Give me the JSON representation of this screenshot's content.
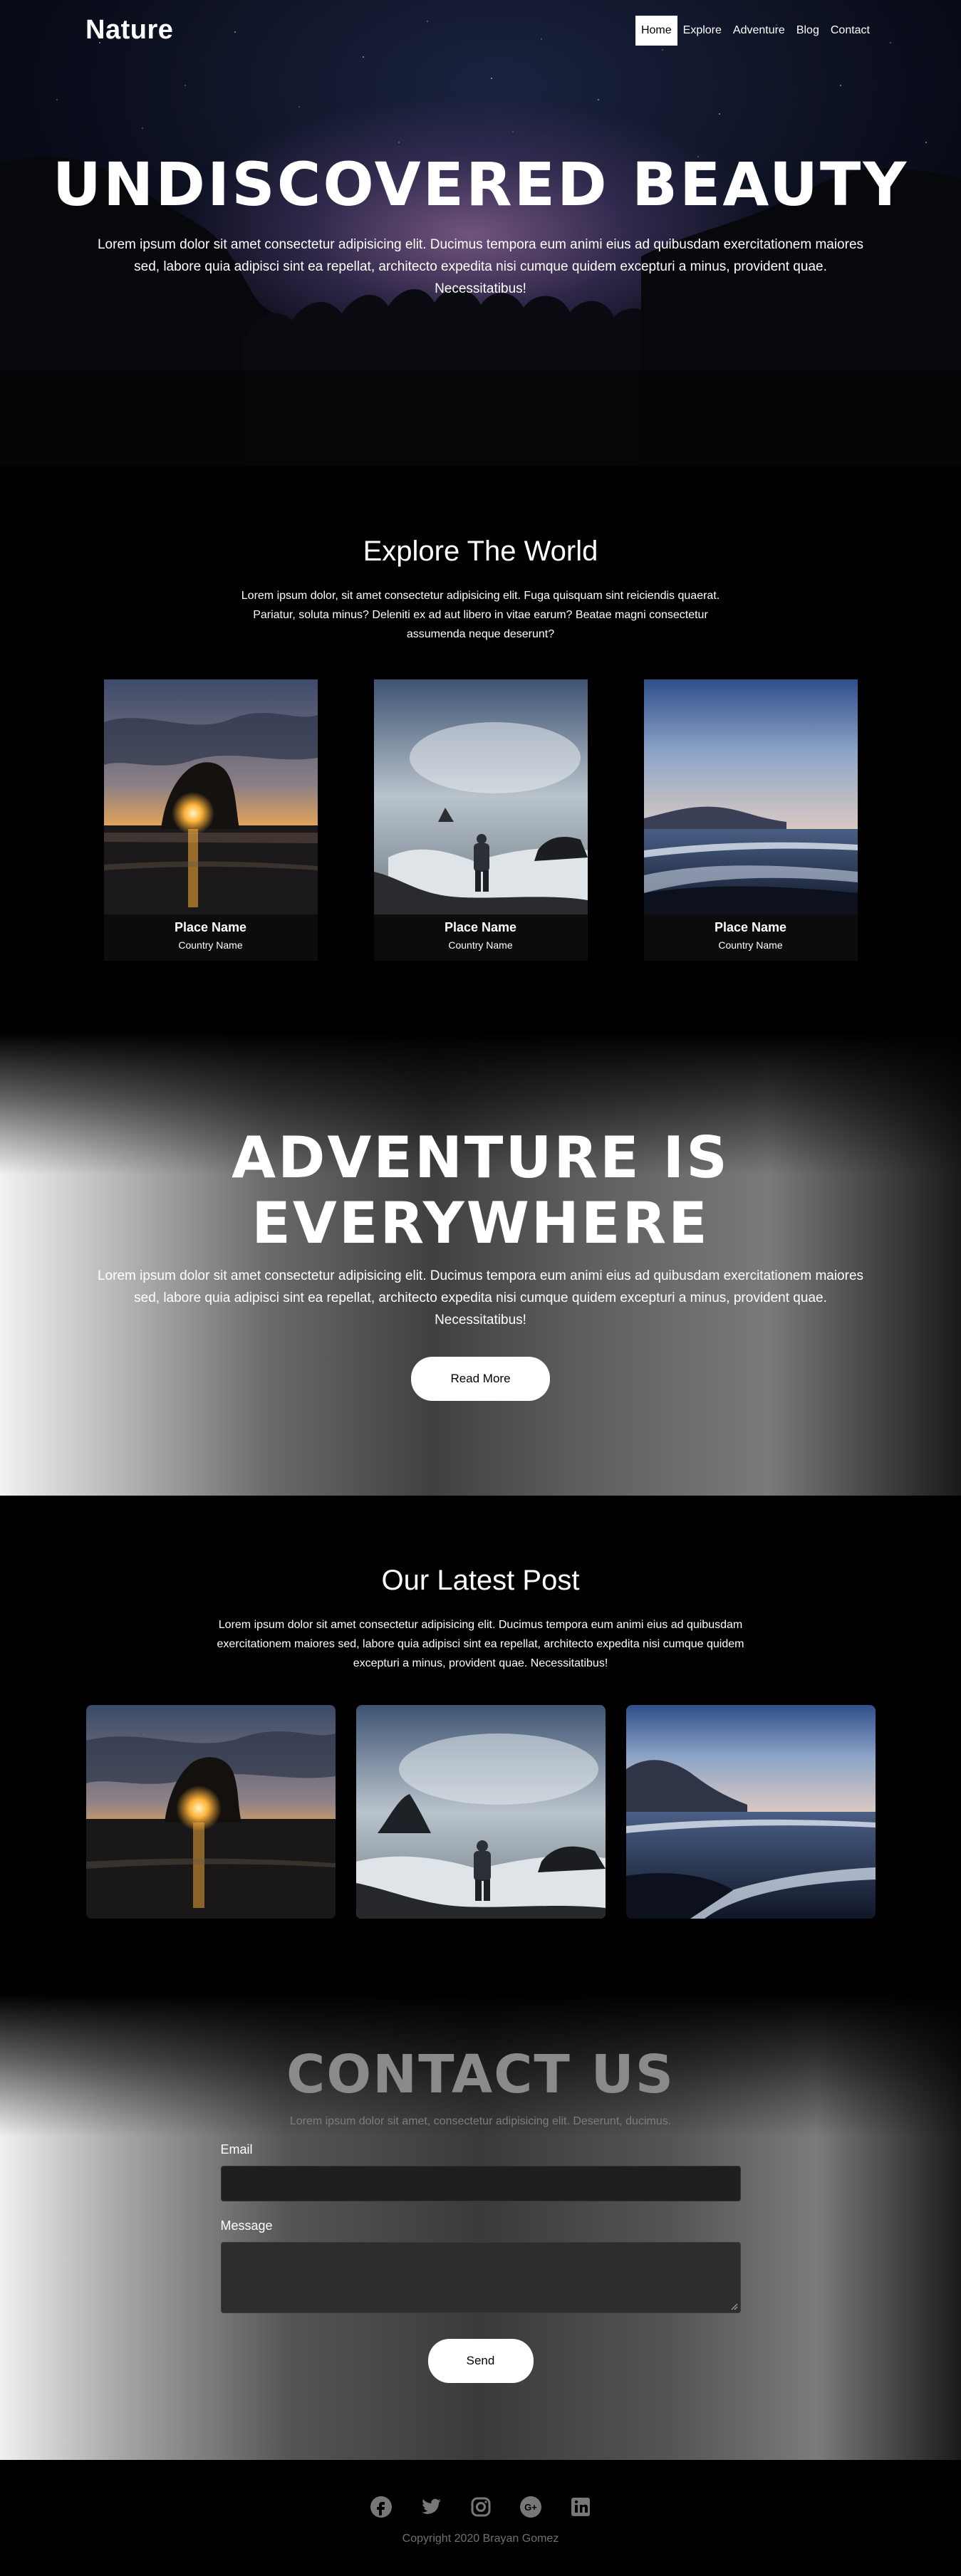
{
  "header": {
    "brand": "Nature",
    "nav": [
      "Home",
      "Explore",
      "Adventure",
      "Blog",
      "Contact"
    ],
    "active_nav": "Home"
  },
  "hero": {
    "title": "UNDISCOVERED BEAUTY",
    "text": "Lorem ipsum dolor sit amet consectetur adipisicing elit. Ducimus tempora eum animi eius ad quibusdam exercitationem maiores sed, labore quia adipisci sint ea repellat, architecto expedita nisi cumque quidem excepturi a minus, provident quae. Necessitatibus!"
  },
  "explore": {
    "title": "Explore The World",
    "text": "Lorem ipsum dolor, sit amet consectetur adipisicing elit. Fuga quisquam sint reiciendis quaerat. Pariatur, soluta minus? Deleniti ex ad aut libero in vitae earum? Beatae magni consectetur assumenda neque deserunt?",
    "cards": [
      {
        "title": "Place Name",
        "subtitle": "Country Name"
      },
      {
        "title": "Place Name",
        "subtitle": "Country Name"
      },
      {
        "title": "Place Name",
        "subtitle": "Country Name"
      }
    ]
  },
  "adventure": {
    "title_line1": "ADVENTURE IS",
    "title_line2": "EVERYWHERE",
    "text": "Lorem ipsum dolor sit amet consectetur adipisicing elit. Ducimus tempora eum animi eius ad quibusdam exercitationem maiores sed, labore quia adipisci sint ea repellat, architecto expedita nisi cumque quidem excepturi a minus, provident quae. Necessitatibus!",
    "button": "Read More"
  },
  "latest": {
    "title": "Our Latest Post",
    "text": "Lorem ipsum dolor sit amet consectetur adipisicing elit. Ducimus tempora eum animi eius ad quibusdam exercitationem maiores sed, labore quia adipisci sint ea repellat, architecto expedita nisi cumque quidem excepturi a minus, provident quae. Necessitatibus!"
  },
  "contact": {
    "title": "CONTACT US",
    "subtitle": "Lorem ipsum dolor sit amet, consectetur adipisicing elit. Deserunt, ducimus.",
    "email_label": "Email",
    "email_value": "",
    "message_label": "Message",
    "message_value": "",
    "button": "Send"
  },
  "footer": {
    "social_icons": [
      "facebook-icon",
      "twitter-icon",
      "instagram-icon",
      "google-plus-icon",
      "linkedin-icon"
    ],
    "copyright": "Copyright 2020 Brayan Gomez"
  }
}
